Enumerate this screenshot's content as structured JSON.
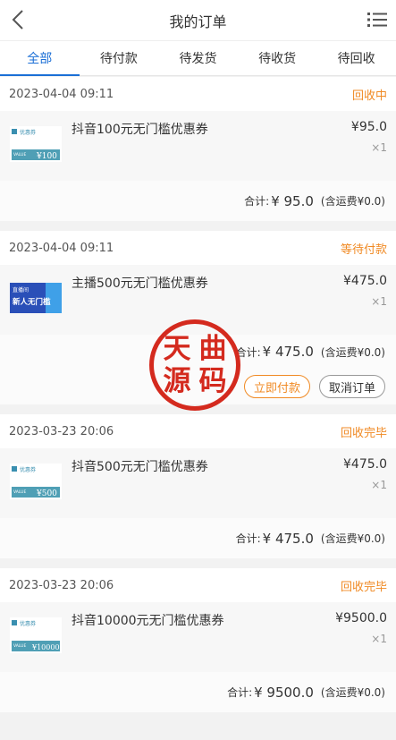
{
  "header": {
    "title": "我的订单",
    "back_icon": "back-arrow-icon",
    "menu_icon": "list-menu-icon"
  },
  "tabs": [
    {
      "label": "全部",
      "active": true
    },
    {
      "label": "待付款",
      "active": false
    },
    {
      "label": "待发货",
      "active": false
    },
    {
      "label": "待收货",
      "active": false
    },
    {
      "label": "待回收",
      "active": false
    }
  ],
  "orders": [
    {
      "date": "2023-04-04 09:11",
      "status": "回收中",
      "item_name": "抖音100元无门槛优惠券",
      "price": "¥95.0",
      "qty": "×1",
      "sum_label": "合计:",
      "sum_value": "¥ 95.0",
      "ship": "(含运费¥0.0)",
      "thumb": {
        "brand": "优惠券",
        "tag": "VALUE",
        "amount": "¥100"
      }
    },
    {
      "date": "2023-04-04 09:11",
      "status": "等待付款",
      "item_name": "主播500元无门槛优惠券",
      "price": "¥475.0",
      "qty": "×1",
      "sum_label": "合计:",
      "sum_value": "¥ 475.0",
      "ship": "(含运费¥0.0)",
      "thumb": {
        "brand": "直播间",
        "tag": "新人无门槛",
        "amount": ""
      },
      "actions": {
        "pay": "立即付款",
        "cancel": "取消订单"
      }
    },
    {
      "date": "2023-03-23 20:06",
      "status": "回收完毕",
      "item_name": "抖音500元无门槛优惠券",
      "price": "¥475.0",
      "qty": "×1",
      "sum_label": "合计:",
      "sum_value": "¥ 475.0",
      "ship": "(含运费¥0.0)",
      "thumb": {
        "brand": "优惠券",
        "tag": "VALUE",
        "amount": "¥500"
      }
    },
    {
      "date": "2023-03-23 20:06",
      "status": "回收完毕",
      "item_name": "抖音10000元无门槛优惠券",
      "price": "¥9500.0",
      "qty": "×1",
      "sum_label": "合计:",
      "sum_value": "¥ 9500.0",
      "ship": "(含运费¥0.0)",
      "thumb": {
        "brand": "优惠券",
        "tag": "VALUE",
        "amount": "¥10000"
      }
    }
  ],
  "watermark": {
    "chars": [
      "天",
      "曲",
      "源",
      "码"
    ],
    "color": "#d42a1e"
  },
  "colors": {
    "accent": "#1b6fd6",
    "status": "#f08a24"
  }
}
